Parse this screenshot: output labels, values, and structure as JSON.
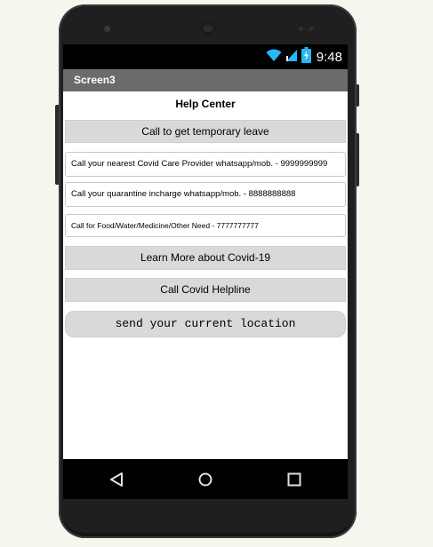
{
  "status": {
    "time": "9:48"
  },
  "app": {
    "screen_title": "Screen3"
  },
  "content": {
    "heading": "Help Center",
    "leave_button": "Call to get temporary leave",
    "covid_care_text": "Call your nearest Covid Care Provider whatsapp/mob. - 9999999999",
    "quarantine_text": "Call your quarantine incharge whatsapp/mob. - 8888888888",
    "food_text": "Call for Food/Water/Medicine/Other Need - 7777777777",
    "learn_button": "Learn More about Covid-19",
    "helpline_button": "Call Covid Helpline",
    "location_button": "send your current location"
  },
  "icons": [
    "wifi-icon",
    "signal-icon",
    "battery-icon",
    "back-icon",
    "home-icon",
    "recents-icon"
  ],
  "colors": {
    "accent_blue": "#29b6f6",
    "titlebar": "#6b6b6b",
    "button_bg": "#d9d9d9"
  }
}
